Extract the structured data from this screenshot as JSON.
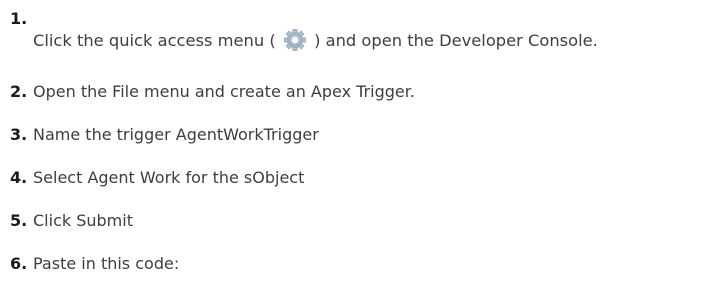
{
  "steps": [
    {
      "number": "1.",
      "before_icon": "Click the quick access menu (",
      "icon": "gear-icon",
      "after_icon": ") and open the Developer Console."
    },
    {
      "number": "2.",
      "text": "Open the File menu and create an Apex Trigger."
    },
    {
      "number": "3.",
      "text": "Name the trigger AgentWorkTrigger"
    },
    {
      "number": "4.",
      "text": "Select Agent Work for the sObject"
    },
    {
      "number": "5.",
      "text": "Click Submit"
    },
    {
      "number": "6.",
      "text": "Paste in this code:"
    }
  ],
  "colors": {
    "number": "#1a1a1a",
    "text": "#3e3e3e",
    "gear": "#8aa0b8"
  }
}
